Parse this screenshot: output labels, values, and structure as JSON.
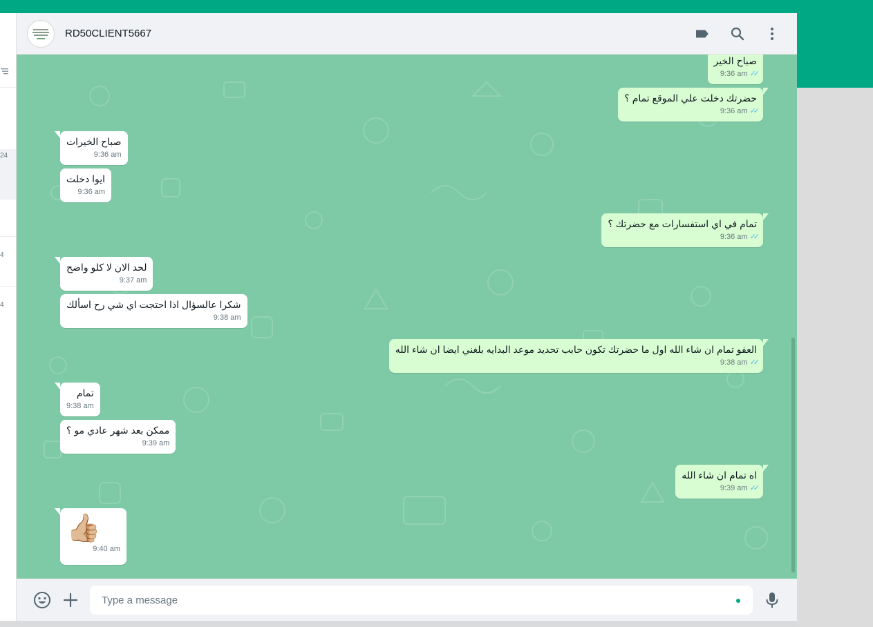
{
  "chat": {
    "contact_name": "RD50CLIENT5667",
    "composer_placeholder": "Type a message"
  },
  "sidebar_fragments": [
    "24",
    "4",
    "4"
  ],
  "colors": {
    "accent": "#00a884",
    "wallpaper": "#7fcaa6",
    "incoming_bubble": "#ffffff",
    "outgoing_bubble": "#d9fdd3",
    "read_ticks": "#53bdeb"
  },
  "icons": {
    "header": [
      "label-icon",
      "search-icon",
      "menu-icon"
    ],
    "composer": [
      "emoji-icon",
      "attach-plus-icon",
      "microphone-icon"
    ]
  },
  "messages": [
    {
      "dir": "out",
      "text": "صباح الخير",
      "time": "9:36 am",
      "read": true
    },
    {
      "dir": "out",
      "text": "حضرتك دخلت علي الموقع تمام ؟",
      "time": "9:36 am",
      "read": true
    },
    {
      "dir": "in",
      "text": "صباح الخيرات",
      "time": "9:36 am"
    },
    {
      "dir": "in",
      "text": "ايوا دخلت",
      "time": "9:36 am"
    },
    {
      "dir": "out",
      "text": "تمام في اي استفسارات مع حضرتك ؟",
      "time": "9:36 am",
      "read": true
    },
    {
      "dir": "in",
      "text": "لحد الان لا كلو واضح",
      "time": "9:37 am"
    },
    {
      "dir": "in",
      "text": "شكرا عالسؤال اذا احتجت اي شي رح اسألك",
      "time": "9:38 am"
    },
    {
      "dir": "out",
      "text": "العفو تمام ان شاء الله اول ما حضرتك تكون حابب تحديد موعد البدايه بلغني ايضا ان شاء الله",
      "time": "9:38 am",
      "read": true
    },
    {
      "dir": "in",
      "text": "تمام",
      "time": "9:38 am"
    },
    {
      "dir": "in",
      "text": "ممكن بعد شهر عادي مو ؟",
      "time": "9:39 am"
    },
    {
      "dir": "out",
      "text": "اه تمام ان شاء الله",
      "time": "9:39 am",
      "read": true
    },
    {
      "dir": "in",
      "text": "👍🏼",
      "time": "9:40 am",
      "emoji": true
    }
  ]
}
